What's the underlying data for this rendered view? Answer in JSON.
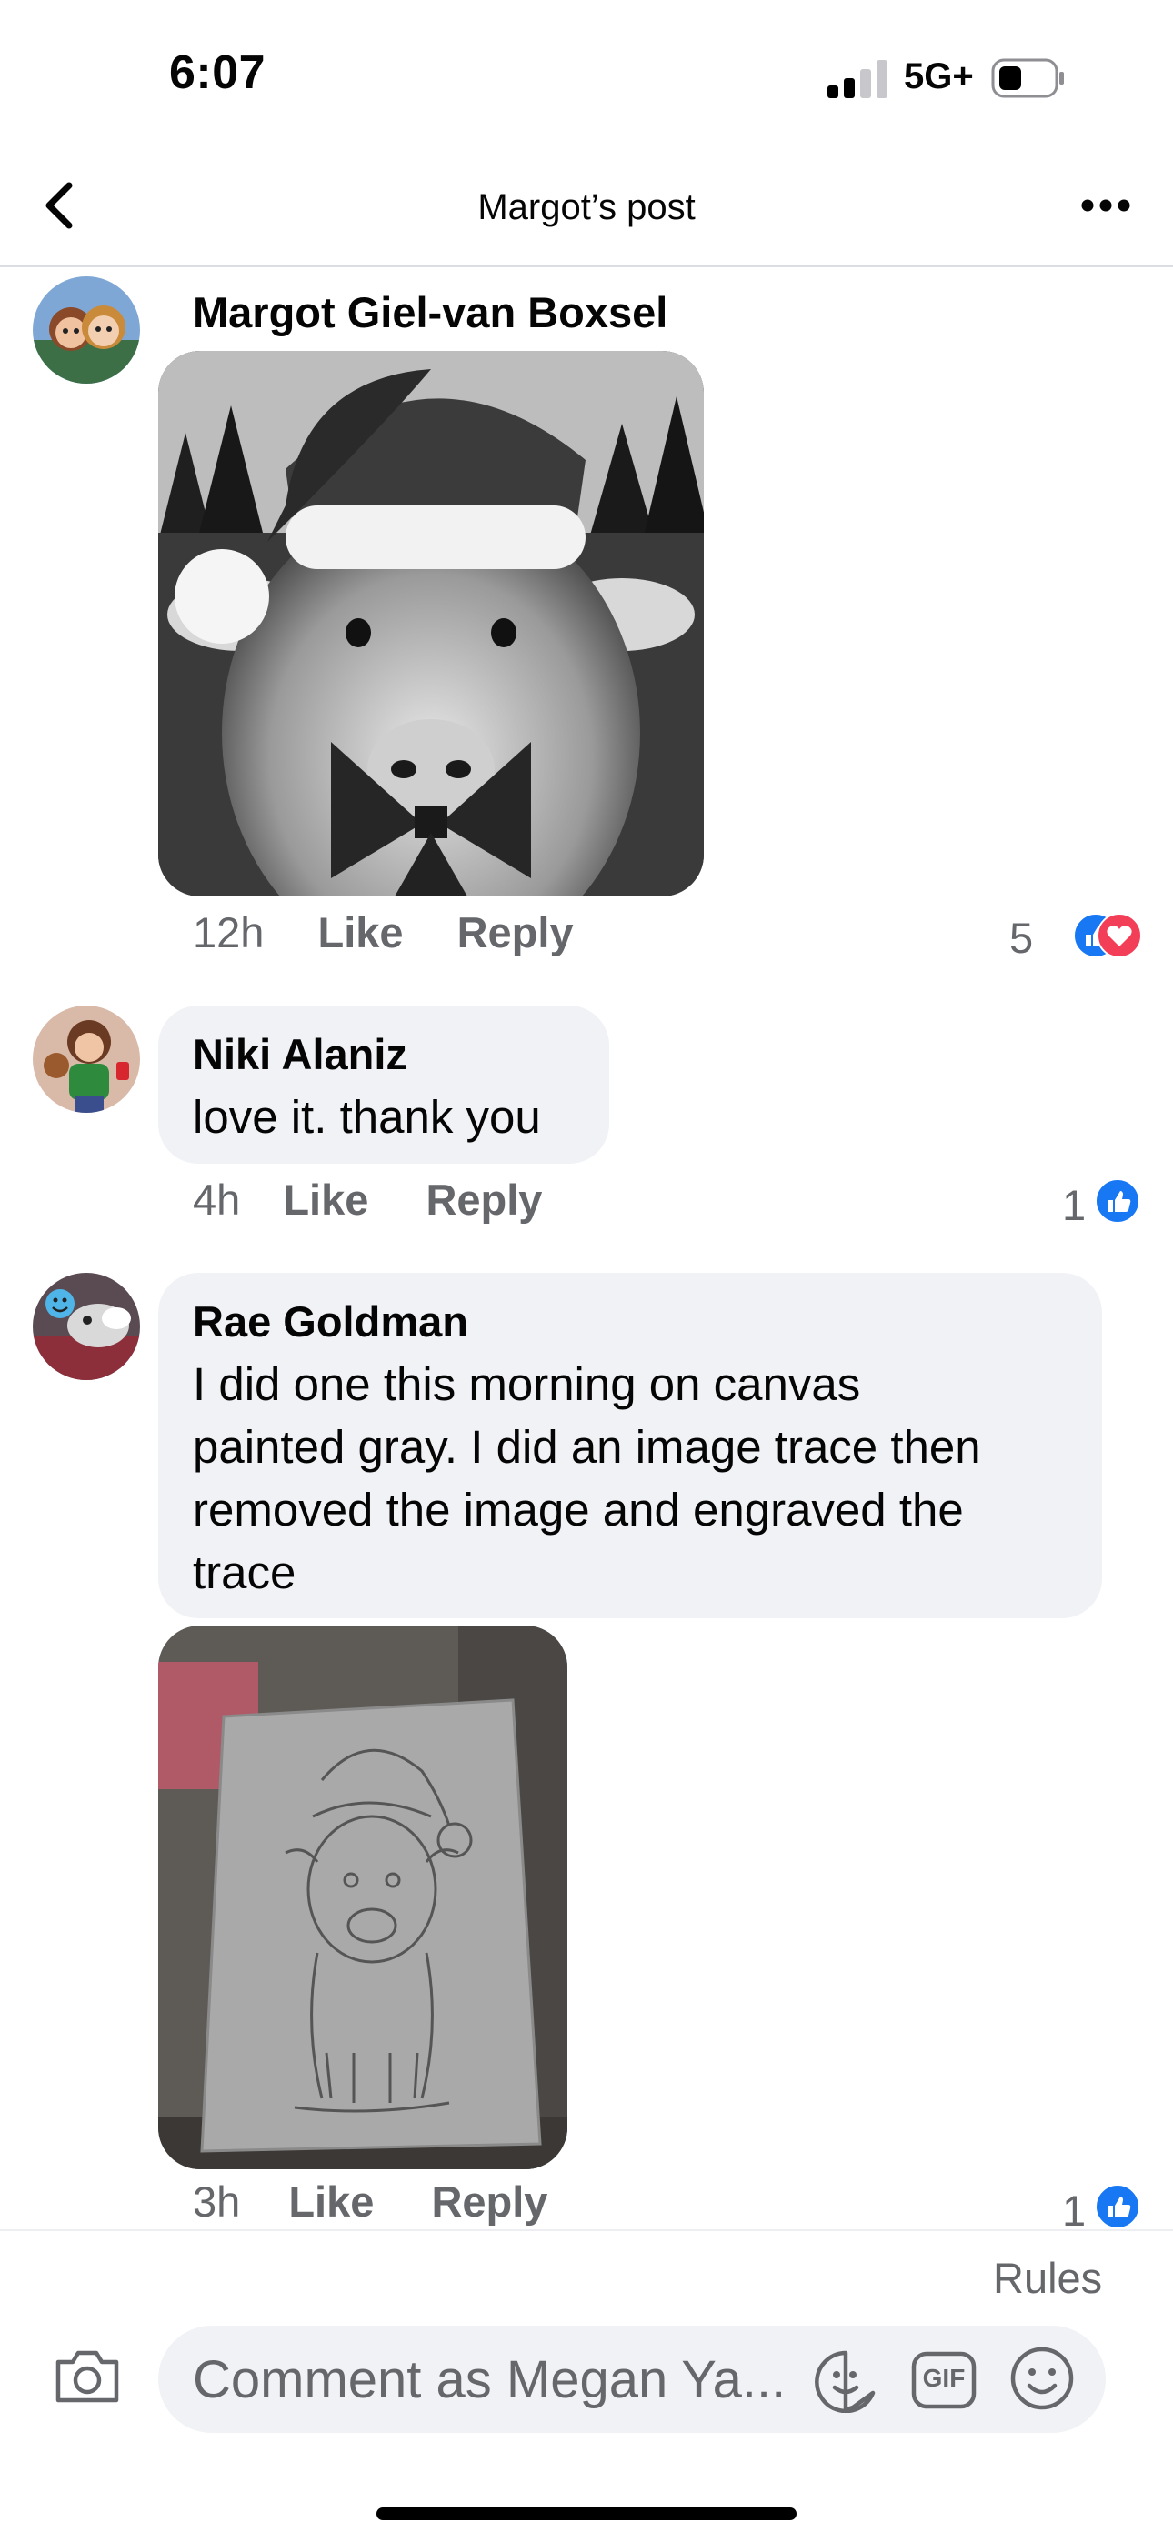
{
  "status_bar": {
    "time": "6:07",
    "network": "5G+",
    "icons": [
      "signal-bars-icon",
      "battery-icon"
    ]
  },
  "nav": {
    "title": "Margot’s post",
    "icons": [
      "back-chevron-icon",
      "more-options-icon"
    ]
  },
  "comments": [
    {
      "author": "Margot Giel-van Boxsel",
      "text": "",
      "has_image": true,
      "image_subject": "highland-calf-santa-hat-photo",
      "time": "12h",
      "like_label": "Like",
      "reply_label": "Reply",
      "reaction_count": "5",
      "reactions": [
        "like",
        "love"
      ]
    },
    {
      "author": "Niki Alaniz",
      "text": "love it. thank you",
      "has_image": false,
      "time": "4h",
      "like_label": "Like",
      "reply_label": "Reply",
      "reaction_count": "1",
      "reactions": [
        "like"
      ]
    },
    {
      "author": "Rae Goldman",
      "text_lines": [
        "I did one this morning on canvas",
        "painted gray. I did an image trace then",
        "removed the image and engraved the",
        "trace"
      ],
      "has_image": true,
      "image_subject": "engraved-canvas-photo",
      "time": "3h",
      "like_label": "Like",
      "reply_label": "Reply",
      "reaction_count": "1",
      "reactions": [
        "like"
      ]
    }
  ],
  "composer": {
    "rules_label": "Rules",
    "placeholder": "Comment as Megan Ya...",
    "icons": [
      "camera-icon",
      "sticker-icon",
      "gif-icon",
      "emoji-icon"
    ],
    "gif_label": "GIF"
  },
  "colors": {
    "like_blue": "#1877f2",
    "love_red": "#f33e58",
    "bubble_gray": "#f0f2f5",
    "meta_gray": "#65676b"
  }
}
